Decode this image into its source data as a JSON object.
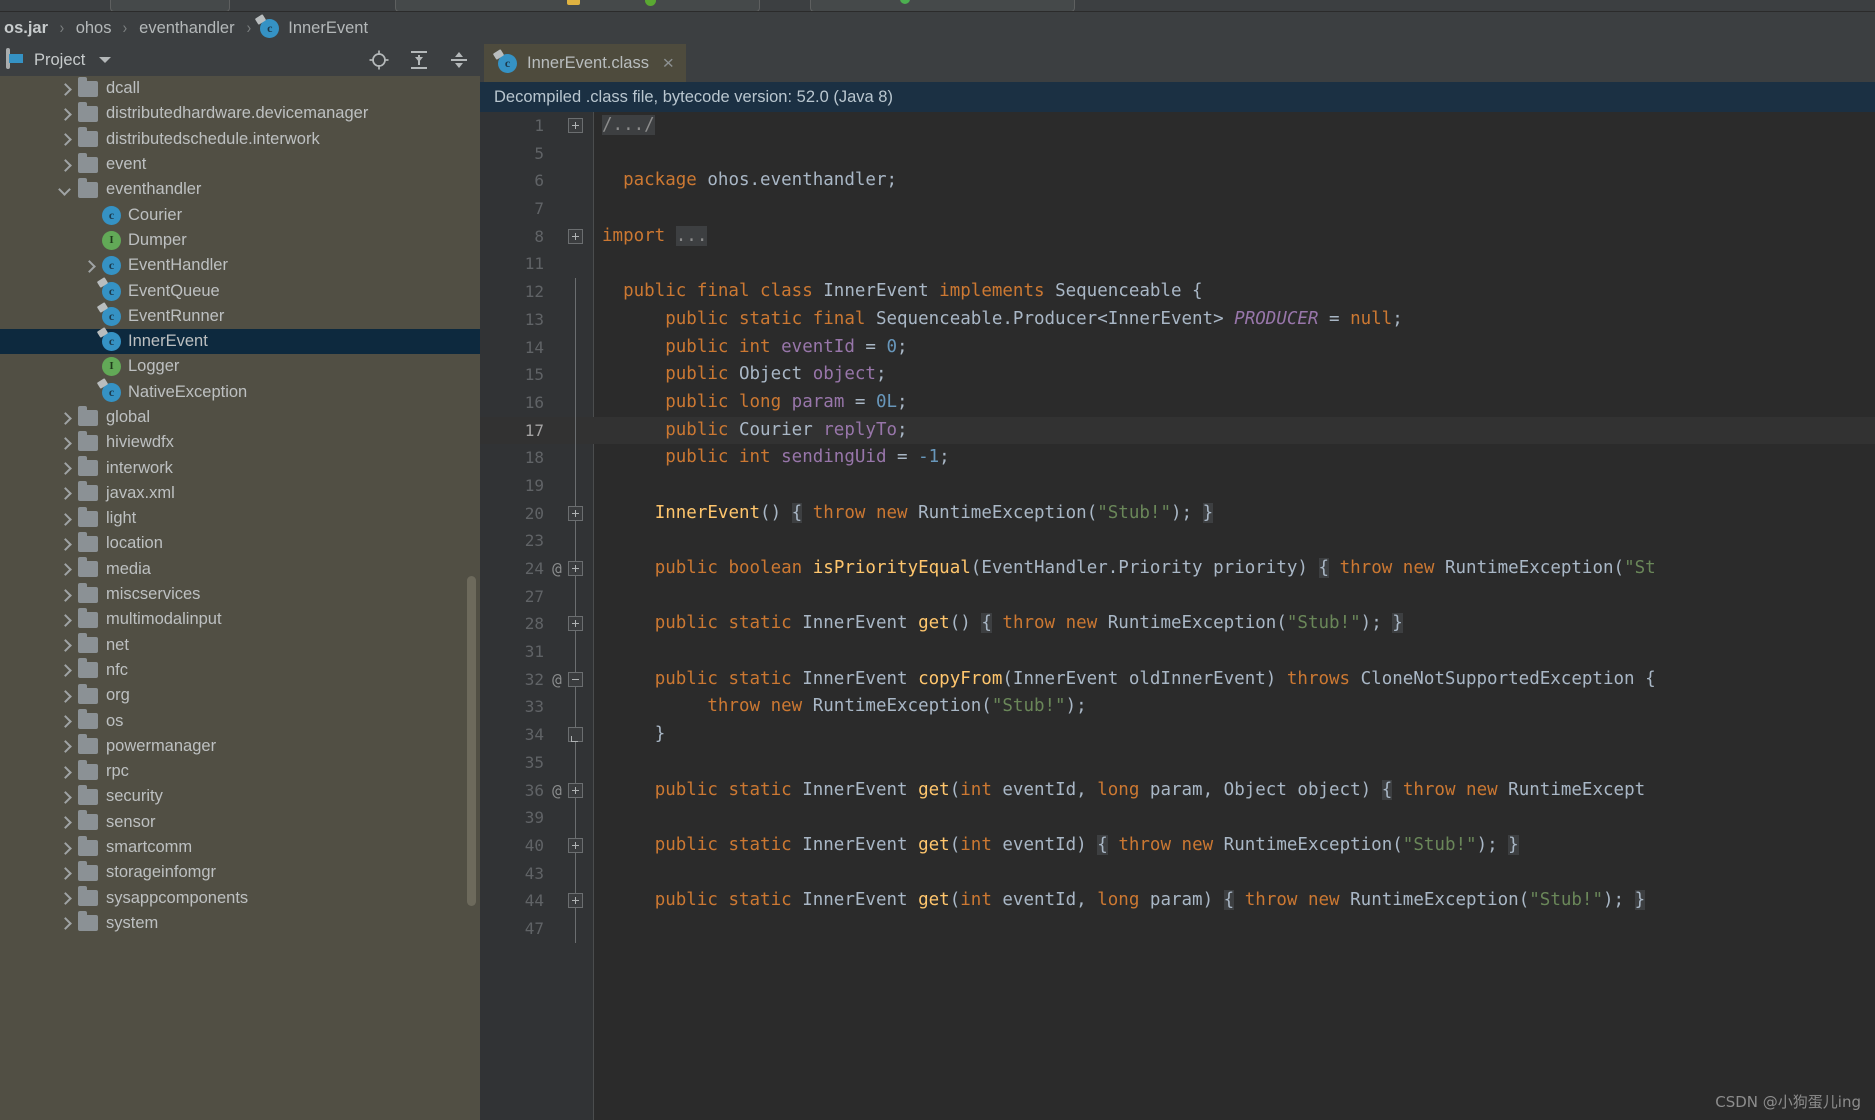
{
  "breadcrumb": {
    "items": [
      {
        "label": "os.jar",
        "type": "jar"
      },
      {
        "label": "ohos",
        "type": "package"
      },
      {
        "label": "eventhandler",
        "type": "package"
      },
      {
        "label": "InnerEvent",
        "type": "class"
      }
    ],
    "separator": "›"
  },
  "project_panel": {
    "title": "Project",
    "icons": [
      "locate-icon",
      "expand-all-icon",
      "collapse-all-icon"
    ]
  },
  "editor_toolbar": {
    "icons": [
      "gear-icon",
      "minimize-icon"
    ]
  },
  "tab": {
    "label": "InnerEvent.class",
    "icon": "class-final-icon",
    "close": "×"
  },
  "notification": {
    "text": "Decompiled .class file, bytecode version: 52.0 (Java 8)"
  },
  "tree": {
    "rows": [
      {
        "indent": 1,
        "arrow": "right",
        "icon": "folder",
        "label": "dcall"
      },
      {
        "indent": 1,
        "arrow": "right",
        "icon": "folder",
        "label": "distributedhardware.devicemanager"
      },
      {
        "indent": 1,
        "arrow": "right",
        "icon": "folder",
        "label": "distributedschedule.interwork"
      },
      {
        "indent": 1,
        "arrow": "right",
        "icon": "folder",
        "label": "event"
      },
      {
        "indent": 1,
        "arrow": "down",
        "icon": "folder",
        "label": "eventhandler"
      },
      {
        "indent": 2,
        "arrow": "none",
        "icon": "class",
        "label": "Courier"
      },
      {
        "indent": 2,
        "arrow": "none",
        "icon": "interface",
        "label": "Dumper"
      },
      {
        "indent": 2,
        "arrow": "right",
        "icon": "class",
        "label": "EventHandler"
      },
      {
        "indent": 2,
        "arrow": "none",
        "icon": "class-final",
        "label": "EventQueue"
      },
      {
        "indent": 2,
        "arrow": "none",
        "icon": "class-final",
        "label": "EventRunner"
      },
      {
        "indent": 2,
        "arrow": "none",
        "icon": "class-final",
        "label": "InnerEvent",
        "selected": true
      },
      {
        "indent": 2,
        "arrow": "none",
        "icon": "interface",
        "label": "Logger"
      },
      {
        "indent": 2,
        "arrow": "none",
        "icon": "class-final",
        "label": "NativeException"
      },
      {
        "indent": 1,
        "arrow": "right",
        "icon": "folder",
        "label": "global"
      },
      {
        "indent": 1,
        "arrow": "right",
        "icon": "folder",
        "label": "hiviewdfx"
      },
      {
        "indent": 1,
        "arrow": "right",
        "icon": "folder",
        "label": "interwork"
      },
      {
        "indent": 1,
        "arrow": "right",
        "icon": "folder",
        "label": "javax.xml"
      },
      {
        "indent": 1,
        "arrow": "right",
        "icon": "folder",
        "label": "light"
      },
      {
        "indent": 1,
        "arrow": "right",
        "icon": "folder",
        "label": "location"
      },
      {
        "indent": 1,
        "arrow": "right",
        "icon": "folder",
        "label": "media"
      },
      {
        "indent": 1,
        "arrow": "right",
        "icon": "folder",
        "label": "miscservices"
      },
      {
        "indent": 1,
        "arrow": "right",
        "icon": "folder",
        "label": "multimodalinput"
      },
      {
        "indent": 1,
        "arrow": "right",
        "icon": "folder",
        "label": "net"
      },
      {
        "indent": 1,
        "arrow": "right",
        "icon": "folder",
        "label": "nfc"
      },
      {
        "indent": 1,
        "arrow": "right",
        "icon": "folder",
        "label": "org"
      },
      {
        "indent": 1,
        "arrow": "right",
        "icon": "folder",
        "label": "os"
      },
      {
        "indent": 1,
        "arrow": "right",
        "icon": "folder",
        "label": "powermanager"
      },
      {
        "indent": 1,
        "arrow": "right",
        "icon": "folder",
        "label": "rpc"
      },
      {
        "indent": 1,
        "arrow": "right",
        "icon": "folder",
        "label": "security"
      },
      {
        "indent": 1,
        "arrow": "right",
        "icon": "folder",
        "label": "sensor"
      },
      {
        "indent": 1,
        "arrow": "right",
        "icon": "folder",
        "label": "smartcomm"
      },
      {
        "indent": 1,
        "arrow": "right",
        "icon": "folder",
        "label": "storageinfomgr"
      },
      {
        "indent": 1,
        "arrow": "right",
        "icon": "folder",
        "label": "sysappcomponents"
      },
      {
        "indent": 1,
        "arrow": "right",
        "icon": "folder",
        "label": "system"
      }
    ]
  },
  "code": {
    "lines": [
      {
        "no": "1",
        "fold": "plus",
        "tokens": [
          {
            "t": "/.../",
            "c": "folded"
          }
        ]
      },
      {
        "no": "5",
        "tokens": []
      },
      {
        "no": "6",
        "tokens": [
          {
            "t": "  ",
            "c": ""
          },
          {
            "t": "package",
            "c": "kw"
          },
          {
            "t": " ohos.eventhandler;",
            "c": "typ"
          }
        ]
      },
      {
        "no": "7",
        "tokens": []
      },
      {
        "no": "8",
        "fold": "plus",
        "tokens": [
          {
            "t": "import",
            "c": "kw"
          },
          {
            "t": " ",
            "c": ""
          },
          {
            "t": "...",
            "c": "folded"
          }
        ]
      },
      {
        "no": "11",
        "tokens": []
      },
      {
        "no": "12",
        "foldline": true,
        "tokens": [
          {
            "t": "  ",
            "c": ""
          },
          {
            "t": "public final class",
            "c": "kw"
          },
          {
            "t": " InnerEvent ",
            "c": "typ"
          },
          {
            "t": "implements",
            "c": "kw"
          },
          {
            "t": " Sequenceable {",
            "c": "typ"
          }
        ]
      },
      {
        "no": "13",
        "foldline": true,
        "tokens": [
          {
            "t": "      ",
            "c": ""
          },
          {
            "t": "public static final",
            "c": "kw"
          },
          {
            "t": " Sequenceable.Producer<InnerEvent> ",
            "c": "typ"
          },
          {
            "t": "PRODUCER",
            "c": "sfld"
          },
          {
            "t": " = ",
            "c": "typ"
          },
          {
            "t": "null",
            "c": "kw"
          },
          {
            "t": ";",
            "c": "typ"
          }
        ]
      },
      {
        "no": "14",
        "foldline": true,
        "tokens": [
          {
            "t": "      ",
            "c": ""
          },
          {
            "t": "public int",
            "c": "kw"
          },
          {
            "t": " ",
            "c": ""
          },
          {
            "t": "eventId",
            "c": "fld"
          },
          {
            "t": " = ",
            "c": "typ"
          },
          {
            "t": "0",
            "c": "num"
          },
          {
            "t": ";",
            "c": "typ"
          }
        ]
      },
      {
        "no": "15",
        "foldline": true,
        "tokens": [
          {
            "t": "      ",
            "c": ""
          },
          {
            "t": "public",
            "c": "kw"
          },
          {
            "t": " Object ",
            "c": "typ"
          },
          {
            "t": "object",
            "c": "fld"
          },
          {
            "t": ";",
            "c": "typ"
          }
        ]
      },
      {
        "no": "16",
        "foldline": true,
        "tokens": [
          {
            "t": "      ",
            "c": ""
          },
          {
            "t": "public long",
            "c": "kw"
          },
          {
            "t": " ",
            "c": ""
          },
          {
            "t": "param",
            "c": "fld"
          },
          {
            "t": " = ",
            "c": "typ"
          },
          {
            "t": "0L",
            "c": "num"
          },
          {
            "t": ";",
            "c": "typ"
          }
        ]
      },
      {
        "no": "17",
        "foldline": true,
        "current": true,
        "tokens": [
          {
            "t": "      ",
            "c": ""
          },
          {
            "t": "public",
            "c": "kw"
          },
          {
            "t": " Courier ",
            "c": "typ"
          },
          {
            "t": "replyTo",
            "c": "fld"
          },
          {
            "t": ";",
            "c": "typ"
          }
        ]
      },
      {
        "no": "18",
        "foldline": true,
        "tokens": [
          {
            "t": "      ",
            "c": ""
          },
          {
            "t": "public int",
            "c": "kw"
          },
          {
            "t": " ",
            "c": ""
          },
          {
            "t": "sendingUid",
            "c": "fld"
          },
          {
            "t": " = ",
            "c": "typ"
          },
          {
            "t": "-1",
            "c": "num"
          },
          {
            "t": ";",
            "c": "typ"
          }
        ]
      },
      {
        "no": "19",
        "foldline": true,
        "tokens": []
      },
      {
        "no": "20",
        "fold": "plus",
        "foldline": true,
        "tokens": [
          {
            "t": "     ",
            "c": ""
          },
          {
            "t": "InnerEvent",
            "c": "mth"
          },
          {
            "t": "() ",
            "c": "typ"
          },
          {
            "t": "{",
            "c": "folded-br"
          },
          {
            "t": " ",
            "c": ""
          },
          {
            "t": "throw new",
            "c": "kw"
          },
          {
            "t": " RuntimeException(",
            "c": "typ"
          },
          {
            "t": "\"Stub!\"",
            "c": "str"
          },
          {
            "t": "); ",
            "c": "typ"
          },
          {
            "t": "}",
            "c": "folded-br"
          }
        ]
      },
      {
        "no": "23",
        "foldline": true,
        "tokens": []
      },
      {
        "no": "24",
        "ann": "@",
        "fold": "plus",
        "foldline": true,
        "tokens": [
          {
            "t": "     ",
            "c": ""
          },
          {
            "t": "public boolean",
            "c": "kw"
          },
          {
            "t": " ",
            "c": ""
          },
          {
            "t": "isPriorityEqual",
            "c": "mth"
          },
          {
            "t": "(EventHandler.Priority priority)",
            "c": "typ"
          },
          {
            "t": " ",
            "c": ""
          },
          {
            "t": "{",
            "c": "folded-br"
          },
          {
            "t": " ",
            "c": ""
          },
          {
            "t": "throw new",
            "c": "kw"
          },
          {
            "t": " RuntimeException(",
            "c": "typ"
          },
          {
            "t": "\"St",
            "c": "str"
          }
        ]
      },
      {
        "no": "27",
        "foldline": true,
        "tokens": []
      },
      {
        "no": "28",
        "fold": "plus",
        "foldline": true,
        "tokens": [
          {
            "t": "     ",
            "c": ""
          },
          {
            "t": "public static",
            "c": "kw"
          },
          {
            "t": " InnerEvent ",
            "c": "typ"
          },
          {
            "t": "get",
            "c": "mth"
          },
          {
            "t": "() ",
            "c": "typ"
          },
          {
            "t": "{",
            "c": "folded-br"
          },
          {
            "t": " ",
            "c": ""
          },
          {
            "t": "throw new",
            "c": "kw"
          },
          {
            "t": " RuntimeException(",
            "c": "typ"
          },
          {
            "t": "\"Stub!\"",
            "c": "str"
          },
          {
            "t": "); ",
            "c": "typ"
          },
          {
            "t": "}",
            "c": "folded-br"
          }
        ]
      },
      {
        "no": "31",
        "foldline": true,
        "tokens": []
      },
      {
        "no": "32",
        "ann": "@",
        "fold": "minus",
        "foldline": true,
        "tokens": [
          {
            "t": "     ",
            "c": ""
          },
          {
            "t": "public static",
            "c": "kw"
          },
          {
            "t": " InnerEvent ",
            "c": "typ"
          },
          {
            "t": "copyFrom",
            "c": "mth"
          },
          {
            "t": "(InnerEvent oldInnerEvent) ",
            "c": "typ"
          },
          {
            "t": "throws",
            "c": "kw"
          },
          {
            "t": " CloneNotSupportedException ",
            "c": "typ"
          },
          {
            "t": "{",
            "c": "typ"
          }
        ]
      },
      {
        "no": "33",
        "foldline": true,
        "tokens": [
          {
            "t": "          ",
            "c": ""
          },
          {
            "t": "throw new",
            "c": "kw"
          },
          {
            "t": " RuntimeException(",
            "c": "typ"
          },
          {
            "t": "\"Stub!\"",
            "c": "str"
          },
          {
            "t": ");",
            "c": "typ"
          }
        ]
      },
      {
        "no": "34",
        "foldend": true,
        "foldline": true,
        "tokens": [
          {
            "t": "     ",
            "c": ""
          },
          {
            "t": "}",
            "c": "typ"
          }
        ]
      },
      {
        "no": "35",
        "foldline": true,
        "tokens": []
      },
      {
        "no": "36",
        "ann": "@",
        "fold": "plus",
        "foldline": true,
        "tokens": [
          {
            "t": "     ",
            "c": ""
          },
          {
            "t": "public static",
            "c": "kw"
          },
          {
            "t": " InnerEvent ",
            "c": "typ"
          },
          {
            "t": "get",
            "c": "mth"
          },
          {
            "t": "(",
            "c": "typ"
          },
          {
            "t": "int",
            "c": "kw"
          },
          {
            "t": " eventId, ",
            "c": "typ"
          },
          {
            "t": "long",
            "c": "kw"
          },
          {
            "t": " param, Object object)",
            "c": "typ"
          },
          {
            "t": " ",
            "c": ""
          },
          {
            "t": "{",
            "c": "folded-br"
          },
          {
            "t": " ",
            "c": ""
          },
          {
            "t": "throw new",
            "c": "kw"
          },
          {
            "t": " RuntimeExcept",
            "c": "typ"
          }
        ]
      },
      {
        "no": "39",
        "foldline": true,
        "tokens": []
      },
      {
        "no": "40",
        "fold": "plus",
        "foldline": true,
        "tokens": [
          {
            "t": "     ",
            "c": ""
          },
          {
            "t": "public static",
            "c": "kw"
          },
          {
            "t": " InnerEvent ",
            "c": "typ"
          },
          {
            "t": "get",
            "c": "mth"
          },
          {
            "t": "(",
            "c": "typ"
          },
          {
            "t": "int",
            "c": "kw"
          },
          {
            "t": " eventId) ",
            "c": "typ"
          },
          {
            "t": "{",
            "c": "folded-br"
          },
          {
            "t": " ",
            "c": ""
          },
          {
            "t": "throw new",
            "c": "kw"
          },
          {
            "t": " RuntimeException(",
            "c": "typ"
          },
          {
            "t": "\"Stub!\"",
            "c": "str"
          },
          {
            "t": "); ",
            "c": "typ"
          },
          {
            "t": "}",
            "c": "folded-br"
          }
        ]
      },
      {
        "no": "43",
        "foldline": true,
        "tokens": []
      },
      {
        "no": "44",
        "fold": "plus",
        "foldline": true,
        "tokens": [
          {
            "t": "     ",
            "c": ""
          },
          {
            "t": "public static",
            "c": "kw"
          },
          {
            "t": " InnerEvent ",
            "c": "typ"
          },
          {
            "t": "get",
            "c": "mth"
          },
          {
            "t": "(",
            "c": "typ"
          },
          {
            "t": "int",
            "c": "kw"
          },
          {
            "t": " eventId, ",
            "c": "typ"
          },
          {
            "t": "long",
            "c": "kw"
          },
          {
            "t": " param) ",
            "c": "typ"
          },
          {
            "t": "{",
            "c": "folded-br"
          },
          {
            "t": " ",
            "c": ""
          },
          {
            "t": "throw new",
            "c": "kw"
          },
          {
            "t": " RuntimeException(",
            "c": "typ"
          },
          {
            "t": "\"Stub!\"",
            "c": "str"
          },
          {
            "t": "); ",
            "c": "typ"
          },
          {
            "t": "}",
            "c": "folded-br"
          }
        ]
      },
      {
        "no": "47",
        "foldline": true,
        "tokens": []
      }
    ]
  },
  "watermark": {
    "text": "CSDN @小狗蛋儿ing"
  }
}
